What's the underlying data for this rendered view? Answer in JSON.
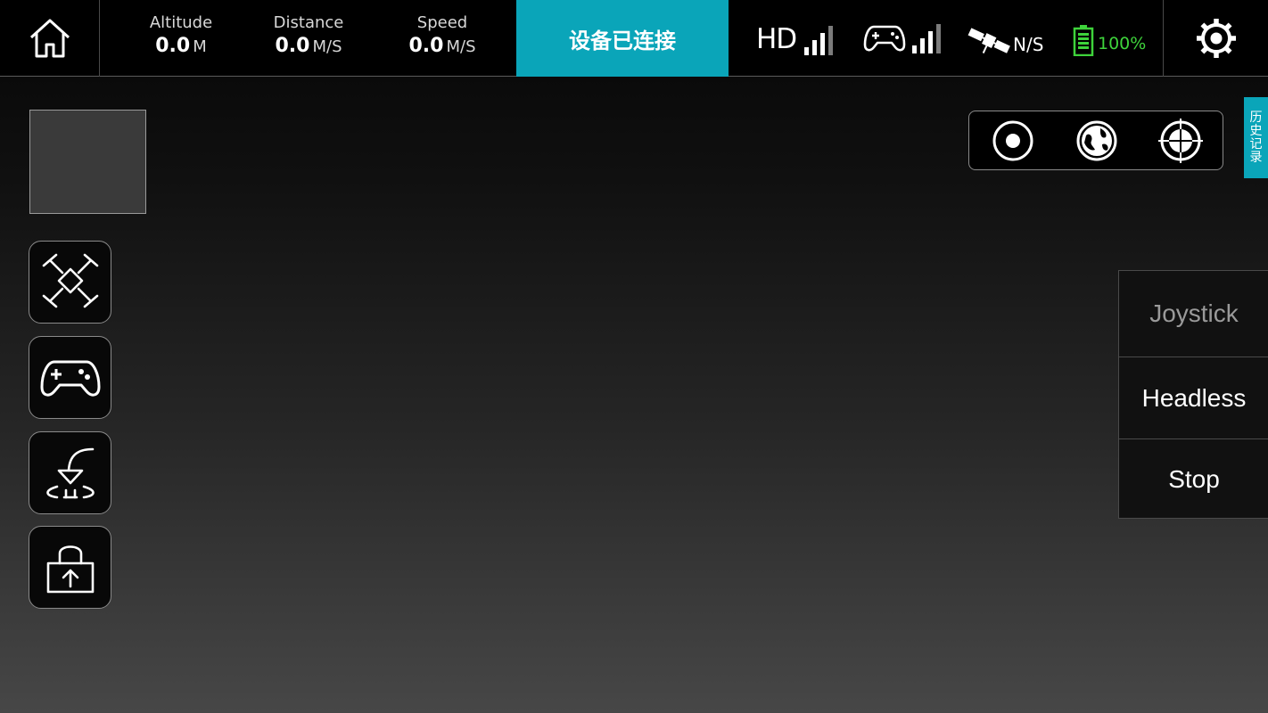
{
  "topbar": {
    "altitude": {
      "label": "Altitude",
      "value": "0.0",
      "unit": "M"
    },
    "distance": {
      "label": "Distance",
      "value": "0.0",
      "unit": "M/S"
    },
    "speed": {
      "label": "Speed",
      "value": "0.0",
      "unit": "M/S"
    },
    "connection_status": "设备已连接",
    "video_signal": {
      "label": "HD",
      "bars": 3,
      "bars_total": 4
    },
    "controller_signal": {
      "icon": "gamepad-icon",
      "bars": 4,
      "bars_total": 4
    },
    "gps": {
      "icon": "satellite-icon",
      "status": "N/S"
    },
    "battery": {
      "icon": "battery-icon",
      "level": "100%"
    },
    "accent_color": "#0aa5b9",
    "battery_color": "#3ed33b"
  },
  "left_tools": [
    {
      "name": "drone-icon"
    },
    {
      "name": "gamepad-icon"
    },
    {
      "name": "takeoff-landing-icon"
    },
    {
      "name": "unlock-upload-icon"
    }
  ],
  "mode_panel": [
    {
      "name": "record-dot-icon"
    },
    {
      "name": "globe-icon"
    },
    {
      "name": "crosshair-icon"
    }
  ],
  "history_tab": {
    "label": "历史记录"
  },
  "control_panel": {
    "joystick_label": "Joystick",
    "headless_label": "Headless",
    "stop_label": "Stop"
  }
}
